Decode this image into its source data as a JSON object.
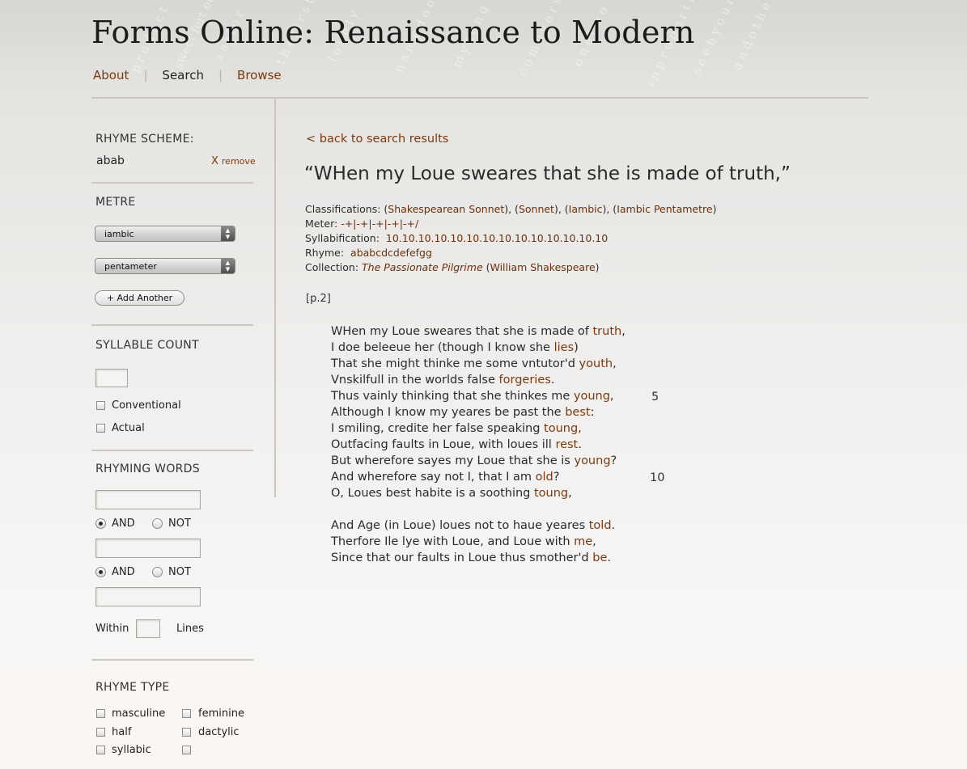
{
  "site": {
    "title": "Forms Online: Renaissance to Modern",
    "nav": [
      {
        "label": "About",
        "active": false
      },
      {
        "label": "Search",
        "active": true
      },
      {
        "label": "Browse",
        "active": false
      }
    ]
  },
  "sidebar": {
    "rhyme_scheme": {
      "heading": "RHYME SCHEME:",
      "value": "abab",
      "remove_x": "X",
      "remove_label": "remove"
    },
    "metre": {
      "heading": "METRE",
      "foot_select": "iambic",
      "length_select": "pentameter",
      "add_another": "+ Add Another"
    },
    "syllable_count": {
      "heading": "SYLLABLE COUNT",
      "input_value": "",
      "options": [
        "Conventional",
        "Actual"
      ]
    },
    "rhyming_words": {
      "heading": "RHYMING WORDS",
      "and_label": "AND",
      "not_label": "NOT",
      "within_label": "Within",
      "lines_label": "Lines"
    },
    "rhyme_type": {
      "heading": "RHYME TYPE",
      "options": [
        "masculine",
        "feminine",
        "half",
        "dactylic",
        "syllabic",
        ""
      ]
    }
  },
  "main": {
    "back_link": "< back to search results",
    "poem_title": "“WHen my Loue sweares that she is made of truth,”",
    "classifications_label": "Classifications:",
    "classifications": [
      "Shakespearean Sonnet",
      "Sonnet",
      "Iambic",
      "Iambic Pentametre"
    ],
    "meter_label": "Meter:",
    "meter_value": "-+|-+|-+|-+|-+/",
    "syllabification_label": "Syllabification:",
    "syllabification_value": "10.10.10.10.10.10.10.10.10.10.10.10.10.10",
    "rhyme_label": "Rhyme:",
    "rhyme_value": "ababcdcdefefgg",
    "collection_label": "Collection:",
    "collection_title": "The Passionate Pilgrime",
    "collection_author": "William Shakespeare",
    "page_marker": "[p.2]",
    "poem_lines": [
      {
        "text": "WHen my Loue sweares that she is made of ",
        "rhyme": "truth",
        "after": ","
      },
      {
        "text": "I doe beleeue her (though I know she ",
        "rhyme": "lies",
        "after": ")"
      },
      {
        "text": "That she might thinke me some vntutor'd ",
        "rhyme": "youth",
        "after": ","
      },
      {
        "text": "Vnskilfull in the worlds false ",
        "rhyme": "forgeries",
        "after": "."
      },
      {
        "text": "Thus vainly thinking that she thinkes me ",
        "rhyme": "young",
        "after": ","
      },
      {
        "text": "Although I know my yeares be past the ",
        "rhyme": "best",
        "after": ":"
      },
      {
        "text": "I smiling, credite her false speaking ",
        "rhyme": "toung",
        "after": ","
      },
      {
        "text": "Outfacing faults in Loue, with loues ill ",
        "rhyme": "rest",
        "after": "."
      },
      {
        "text": "But wherefore sayes my Loue that she is ",
        "rhyme": "young",
        "after": "?"
      },
      {
        "text": "And wherefore say not I, that I am ",
        "rhyme": "old",
        "after": "?"
      },
      {
        "text": "O, Loues best habite is a soothing ",
        "rhyme": "toung",
        "after": ","
      },
      {
        "text": "And Age (in Loue) loues not to haue yeares ",
        "rhyme": "told",
        "after": "."
      },
      {
        "text": "Therfore Ile lye with Loue, and Loue with ",
        "rhyme": "me",
        "after": ","
      },
      {
        "text": "Since that our faults in Loue thus smother'd ",
        "rhyme": "be",
        "after": "."
      }
    ],
    "line_numbers": [
      "5",
      "10"
    ]
  }
}
